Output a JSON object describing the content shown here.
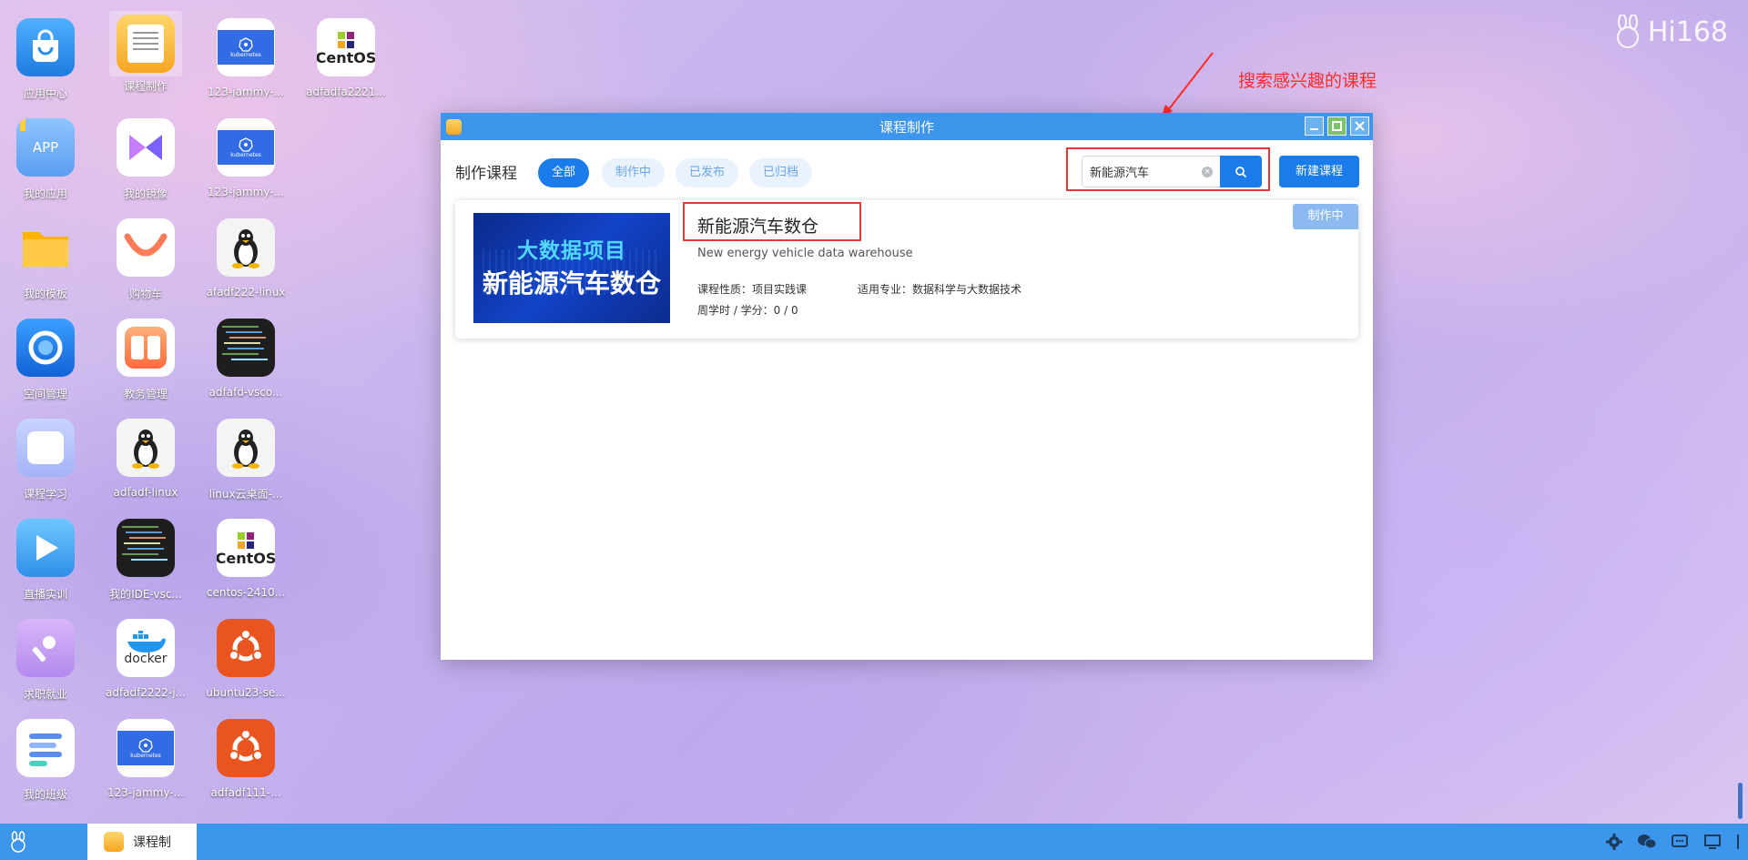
{
  "desktop": {
    "icons": [
      {
        "label": "应用中心",
        "icon": "app-center-icon"
      },
      {
        "label": "课程制作",
        "icon": "course-make-icon"
      },
      {
        "label": "123-jammy-...",
        "icon": "kubernetes-icon"
      },
      {
        "label": "adfadfa2221...",
        "icon": "centos-icon"
      },
      {
        "label": "我的应用",
        "icon": "my-apps-icon"
      },
      {
        "label": "我的镜像",
        "icon": "my-images-icon"
      },
      {
        "label": "123-jammy-...",
        "icon": "kubernetes-icon"
      },
      {
        "label": "我的模板",
        "icon": "folder-icon"
      },
      {
        "label": "购物车",
        "icon": "cart-icon"
      },
      {
        "label": "afadf222-linux",
        "icon": "linux-icon"
      },
      {
        "label": "空间管理",
        "icon": "space-manage-icon"
      },
      {
        "label": "教务管理",
        "icon": "academic-icon"
      },
      {
        "label": "adfafd-vsco...",
        "icon": "code-icon"
      },
      {
        "label": "课程学习",
        "icon": "course-learn-icon"
      },
      {
        "label": "adfadf-linux",
        "icon": "linux-icon"
      },
      {
        "label": "linux云桌面-...",
        "icon": "linux-icon"
      },
      {
        "label": "直播实训",
        "icon": "live-icon"
      },
      {
        "label": "我的IDE-vsc...",
        "icon": "code-icon"
      },
      {
        "label": "centos-2410...",
        "icon": "centos-icon"
      },
      {
        "label": "求职就业",
        "icon": "job-icon"
      },
      {
        "label": "adfadf2222-j...",
        "icon": "docker-icon"
      },
      {
        "label": "ubuntu23-se...",
        "icon": "ubuntu-icon"
      },
      {
        "label": "我的班级",
        "icon": "my-class-icon"
      },
      {
        "label": "123-jammy-...",
        "icon": "kubernetes-icon"
      },
      {
        "label": "adfadf111-...",
        "icon": "ubuntu-icon"
      }
    ],
    "brand": "Hi168",
    "annotation": "搜索感兴趣的课程"
  },
  "window": {
    "title": "课程制作",
    "toolbar_title": "制作课程",
    "tabs": [
      "全部",
      "制作中",
      "已发布",
      "已归档"
    ],
    "search_value": "新能源汽车",
    "new_button": "新建课程"
  },
  "course": {
    "thumb_line1": "大数据项目",
    "thumb_line2": "新能源汽车数仓",
    "name": "新能源汽车数仓",
    "name_en": "New energy vehicle data warehouse",
    "nature": "课程性质：项目实践课",
    "major": "适用专业：数据科学与大数据技术",
    "hours": "周学时 / 学分：0 / 0",
    "status": "制作中"
  },
  "taskbar": {
    "app_label": "课程制"
  },
  "colors": {
    "primary": "#1a7bea",
    "titlebar": "#3d95ec",
    "annotation": "#ff2b2b"
  }
}
